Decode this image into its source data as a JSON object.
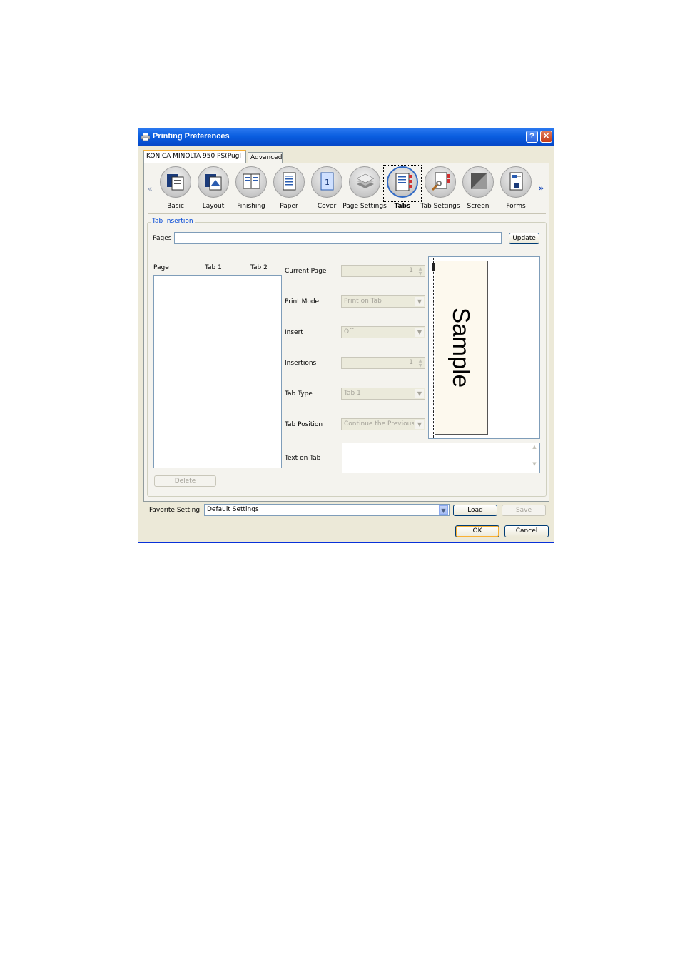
{
  "window": {
    "title": "Printing Preferences",
    "help_label": "?",
    "close_label": "✕"
  },
  "tabs": [
    {
      "label": "KONICA MINOLTA 950 PS(PugI",
      "active": true
    },
    {
      "label": "Advanced",
      "active": false
    }
  ],
  "nav": {
    "left": "«",
    "right": "»"
  },
  "toolbar": [
    {
      "label": "Basic",
      "icon": "basic-icon"
    },
    {
      "label": "Layout",
      "icon": "layout-icon"
    },
    {
      "label": "Finishing",
      "icon": "finishing-icon"
    },
    {
      "label": "Paper",
      "icon": "paper-icon"
    },
    {
      "label": "Cover",
      "icon": "cover-icon"
    },
    {
      "label": "Page Settings",
      "icon": "page-settings-icon"
    },
    {
      "label": "Tabs",
      "icon": "tabs-icon",
      "active": true
    },
    {
      "label": "Tab Settings",
      "icon": "tab-settings-icon"
    },
    {
      "label": "Screen",
      "icon": "screen-icon"
    },
    {
      "label": "Forms",
      "icon": "forms-icon"
    }
  ],
  "tab_insertion": {
    "group_title": "Tab Insertion",
    "pages_label": "Pages",
    "pages_value": "",
    "update_label": "Update",
    "list_headers": {
      "page": "Page",
      "tab1": "Tab 1",
      "tab2": "Tab 2"
    },
    "delete_label": "Delete",
    "fields": {
      "current_page": {
        "label": "Current Page",
        "value": "1"
      },
      "print_mode": {
        "label": "Print Mode",
        "value": "Print on Tab"
      },
      "insert": {
        "label": "Insert",
        "value": "Off"
      },
      "insertions": {
        "label": "Insertions",
        "value": "1"
      },
      "tab_type": {
        "label": "Tab Type",
        "value": "Tab 1"
      },
      "tab_position": {
        "label": "Tab Position",
        "value": "Continue the Previous P"
      },
      "text_on_tab": {
        "label": "Text on Tab",
        "value": ""
      }
    },
    "preview_text": "Sample"
  },
  "favorite": {
    "label": "Favorite Setting",
    "value": "Default Settings",
    "load_label": "Load",
    "save_label": "Save"
  },
  "dialog": {
    "ok_label": "OK",
    "cancel_label": "Cancel"
  }
}
